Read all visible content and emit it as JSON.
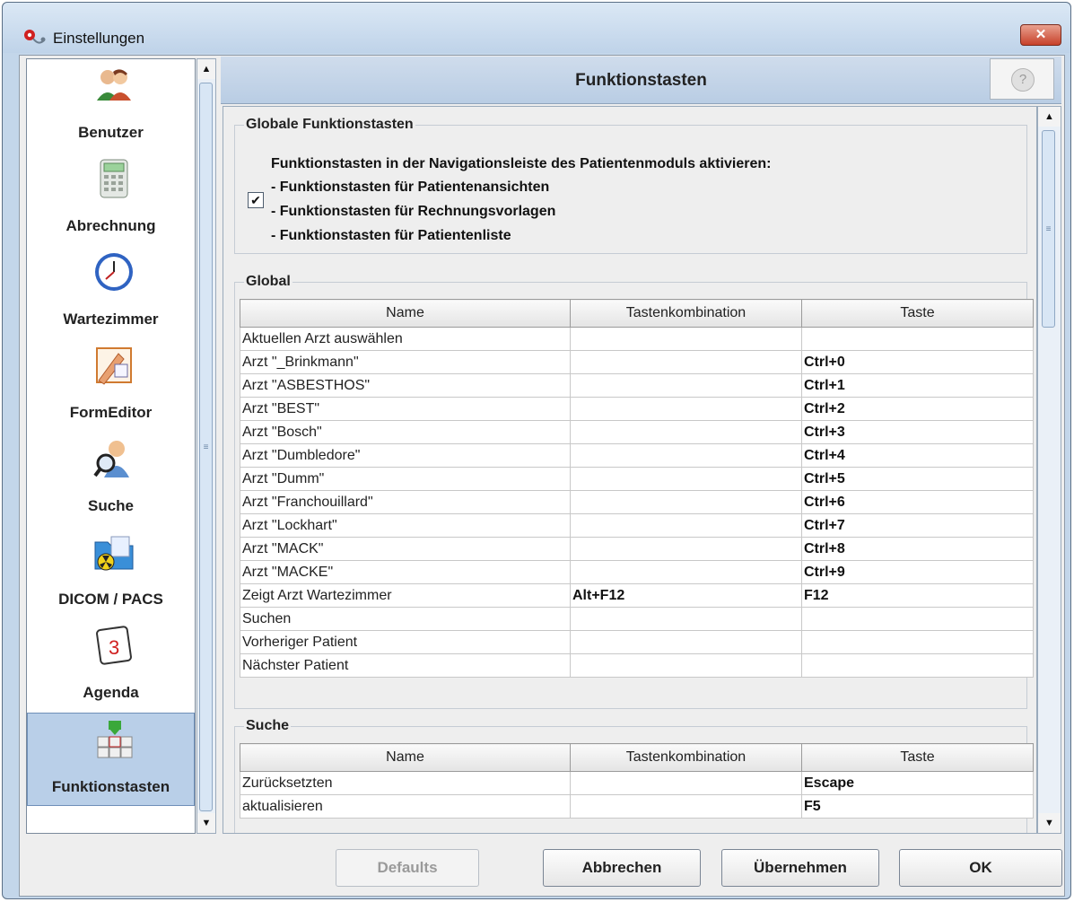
{
  "window": {
    "title": "Einstellungen",
    "close_label": "✕"
  },
  "sidebar": {
    "items": [
      {
        "label": "Benutzer",
        "icon": "users-icon"
      },
      {
        "label": "Abrechnung",
        "icon": "calculator-icon"
      },
      {
        "label": "Wartezimmer",
        "icon": "clock-icon"
      },
      {
        "label": "FormEditor",
        "icon": "form-editor-icon"
      },
      {
        "label": "Suche",
        "icon": "search-user-icon"
      },
      {
        "label": "DICOM / PACS",
        "icon": "dicom-folder-icon"
      },
      {
        "label": "Agenda",
        "icon": "calendar-icon"
      },
      {
        "label": "Funktionstasten",
        "icon": "keyboard-icon",
        "active": true
      }
    ]
  },
  "header": {
    "title": "Funktionstasten",
    "help_label": "?"
  },
  "globale": {
    "title": "Globale Funktionstasten",
    "heading": "Funktionstasten in der Navigationsleiste des Patientenmoduls aktivieren:",
    "checked": true,
    "lines": [
      "- Funktionstasten für Patientenansichten",
      "- Funktionstasten für Rechnungsvorlagen",
      "- Funktionstasten für Patientenliste"
    ]
  },
  "global_table": {
    "title": "Global",
    "columns": [
      "Name",
      "Tastenkombination",
      "Taste"
    ],
    "rows": [
      [
        "Aktuellen Arzt auswählen",
        "",
        ""
      ],
      [
        "Arzt \"_Brinkmann\"",
        "",
        "Ctrl+0"
      ],
      [
        "Arzt \"ASBESTHOS\"",
        "",
        "Ctrl+1"
      ],
      [
        "Arzt \"BEST\"",
        "",
        "Ctrl+2"
      ],
      [
        "Arzt \"Bosch\"",
        "",
        "Ctrl+3"
      ],
      [
        "Arzt \"Dumbledore\"",
        "",
        "Ctrl+4"
      ],
      [
        "Arzt \"Dumm\"",
        "",
        "Ctrl+5"
      ],
      [
        "Arzt \"Franchouillard\"",
        "",
        "Ctrl+6"
      ],
      [
        "Arzt \"Lockhart\"",
        "",
        "Ctrl+7"
      ],
      [
        "Arzt \"MACK\"",
        "",
        "Ctrl+8"
      ],
      [
        "Arzt \"MACKE\"",
        "",
        "Ctrl+9"
      ],
      [
        "Zeigt Arzt Wartezimmer",
        "Alt+F12",
        "F12"
      ],
      [
        "Suchen",
        "",
        ""
      ],
      [
        "Vorheriger Patient",
        "",
        ""
      ],
      [
        "Nächster Patient",
        "",
        ""
      ]
    ]
  },
  "suche_table": {
    "title": "Suche",
    "columns": [
      "Name",
      "Tastenkombination",
      "Taste"
    ],
    "rows": [
      [
        "Zurücksetzten",
        "",
        "Escape"
      ],
      [
        "aktualisieren",
        "",
        "F5"
      ]
    ]
  },
  "footer": {
    "defaults": "Defaults",
    "cancel": "Abbrechen",
    "apply": "Übernehmen",
    "ok": "OK"
  }
}
